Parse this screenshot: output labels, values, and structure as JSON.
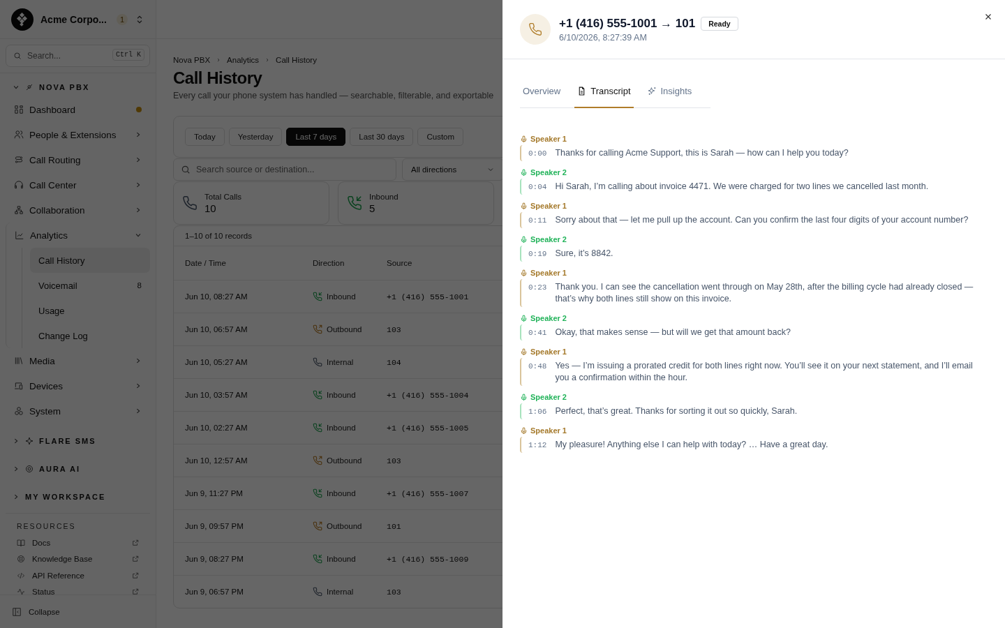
{
  "sidebar": {
    "org": {
      "name": "Acme Corpo...",
      "badge": "1"
    },
    "search": {
      "placeholder": "Search...",
      "shortcut": "Ctrl K"
    },
    "sections": [
      {
        "title": "NOVA PBX",
        "expanded": true,
        "items": [
          {
            "label": "Dashboard",
            "selected": false,
            "dot": true
          },
          {
            "label": "People & Extensions",
            "selected": false,
            "expanded": false
          },
          {
            "label": "Call Routing",
            "selected": false,
            "expanded": false
          },
          {
            "label": "Call Center",
            "selected": false,
            "expanded": false
          },
          {
            "label": "Collaboration",
            "selected": false,
            "expanded": false
          },
          {
            "label": "Analytics",
            "selected": false,
            "expanded": true,
            "children": [
              {
                "label": "Call History",
                "selected": true
              },
              {
                "label": "Voicemail",
                "selected": false,
                "badge": "8"
              },
              {
                "label": "Usage",
                "selected": false
              },
              {
                "label": "Change Log",
                "selected": false
              }
            ]
          },
          {
            "label": "Media",
            "selected": false,
            "expanded": false
          },
          {
            "label": "Devices",
            "selected": false,
            "expanded": false
          },
          {
            "label": "System",
            "selected": false,
            "expanded": false
          }
        ]
      },
      {
        "title": "FLARE SMS",
        "expanded": false
      },
      {
        "title": "AURA AI",
        "expanded": false
      },
      {
        "title": "MY WORKSPACE",
        "expanded": false
      }
    ],
    "resources": {
      "title": "RESOURCES",
      "items": [
        "Docs",
        "Knowledge Base",
        "API Reference",
        "Status"
      ]
    },
    "collapse": "Collapse"
  },
  "main": {
    "breadcrumb": [
      "Nova PBX",
      "Analytics",
      "Call History"
    ],
    "title": "Call History",
    "subtitle": "Every call your phone system has handled — searchable, filterable, and exportable",
    "ranges": [
      {
        "label": "Today",
        "selected": false
      },
      {
        "label": "Yesterday",
        "selected": false
      },
      {
        "label": "Last 7 days",
        "selected": true
      },
      {
        "label": "Last 30 days",
        "selected": false
      },
      {
        "label": "Custom",
        "selected": false
      }
    ],
    "search": {
      "placeholder": "Search source or destination..."
    },
    "direction_filter": "All directions",
    "stats": [
      {
        "kind": "total",
        "label": "Total Calls",
        "value": "10"
      },
      {
        "kind": "inbound",
        "label": "Inbound",
        "value": "5"
      }
    ],
    "records": "1–10 of 10 records",
    "table": {
      "columns": [
        "Date / Time",
        "Direction",
        "Source"
      ],
      "rows": [
        {
          "time": "Jun 10, 08:27 AM",
          "direction": {
            "kind": "inbound",
            "label": "Inbound"
          },
          "source": "+1 (416) 555-1001"
        },
        {
          "time": "Jun 10, 06:57 AM",
          "direction": {
            "kind": "outbound",
            "label": "Outbound"
          },
          "source": "103"
        },
        {
          "time": "Jun 10, 05:27 AM",
          "direction": {
            "kind": "internal",
            "label": "Internal"
          },
          "source": "104"
        },
        {
          "time": "Jun 10, 03:57 AM",
          "direction": {
            "kind": "inbound",
            "label": "Inbound"
          },
          "source": "+1 (416) 555-1004"
        },
        {
          "time": "Jun 10, 02:27 AM",
          "direction": {
            "kind": "inbound",
            "label": "Inbound"
          },
          "source": "+1 (416) 555-1005"
        },
        {
          "time": "Jun 10, 12:57 AM",
          "direction": {
            "kind": "outbound",
            "label": "Outbound"
          },
          "source": "103"
        },
        {
          "time": "Jun 9, 11:27 PM",
          "direction": {
            "kind": "inbound",
            "label": "Inbound"
          },
          "source": "+1 (416) 555-1007"
        },
        {
          "time": "Jun 9, 09:57 PM",
          "direction": {
            "kind": "outbound",
            "label": "Outbound"
          },
          "source": "101"
        },
        {
          "time": "Jun 9, 08:27 PM",
          "direction": {
            "kind": "inbound",
            "label": "Inbound"
          },
          "source": "+1 (416) 555-1009"
        },
        {
          "time": "Jun 9, 06:57 PM",
          "direction": {
            "kind": "internal",
            "label": "Internal"
          },
          "source": "103"
        }
      ]
    }
  },
  "panel": {
    "title": "+1 (416) 555-1001 → 101",
    "status": "Ready",
    "timestamp": "6/10/2026, 8:27:39 AM",
    "tabs": [
      {
        "kind": "plain",
        "label": "Overview",
        "selected": false
      },
      {
        "kind": "document",
        "label": "Transcript",
        "selected": true
      },
      {
        "kind": "sparkle",
        "label": "Insights",
        "selected": false
      }
    ],
    "transcript": [
      {
        "kind": "agent",
        "speaker": "Speaker 1",
        "time": "0:00",
        "text": "Thanks for calling Acme Support, this is Sarah — how can I help you today?"
      },
      {
        "kind": "caller",
        "speaker": "Speaker 2",
        "time": "0:04",
        "text": "Hi Sarah, I’m calling about invoice 4471. We were charged for two lines we cancelled last month."
      },
      {
        "kind": "agent",
        "speaker": "Speaker 1",
        "time": "0:11",
        "text": "Sorry about that — let me pull up the account. Can you confirm the last four digits of your account number?"
      },
      {
        "kind": "caller",
        "speaker": "Speaker 2",
        "time": "0:19",
        "text": "Sure, it’s 8842."
      },
      {
        "kind": "agent",
        "speaker": "Speaker 1",
        "time": "0:23",
        "text": "Thank you. I can see the cancellation went through on May 28th, after the billing cycle had already closed — that’s why both lines still show on this invoice."
      },
      {
        "kind": "caller",
        "speaker": "Speaker 2",
        "time": "0:41",
        "text": "Okay, that makes sense — but will we get that amount back?"
      },
      {
        "kind": "agent",
        "speaker": "Speaker 1",
        "time": "0:48",
        "text": "Yes — I’m issuing a prorated credit for both lines right now. You’ll see it on your next statement, and I’ll email you a confirmation within the hour."
      },
      {
        "kind": "caller",
        "speaker": "Speaker 2",
        "time": "1:06",
        "text": "Perfect, that’s great. Thanks for sorting it out so quickly, Sarah."
      },
      {
        "kind": "agent",
        "speaker": "Speaker 1",
        "time": "1:12",
        "text": "My pleasure! Anything else I can help with today? … Have a great day."
      }
    ]
  }
}
